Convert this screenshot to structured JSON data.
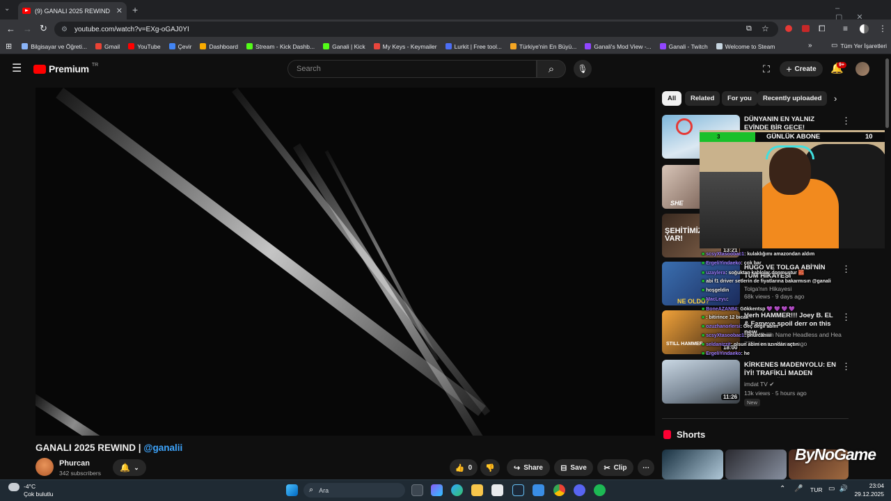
{
  "browser": {
    "tab_title": "(9) GANALI 2025 REWIND | @ga",
    "url": "youtube.com/watch?v=EXg-oGAJ0YI",
    "bookmarks": [
      {
        "label": "Bilgisayar ve Öğreti...",
        "color": "#8ab4f8"
      },
      {
        "label": "Gmail",
        "color": "#ea4335"
      },
      {
        "label": "YouTube",
        "color": "#ff0000"
      },
      {
        "label": "Çevir",
        "color": "#4285f4"
      },
      {
        "label": "Dashboard",
        "color": "#f9ab00"
      },
      {
        "label": "Stream - Kick Dashb...",
        "color": "#53fc18"
      },
      {
        "label": "Ganali | Kick",
        "color": "#53fc18"
      },
      {
        "label": "My Keys - Keymailer",
        "color": "#e8453c"
      },
      {
        "label": "Lurkit | Free tool...",
        "color": "#4c6ef5"
      },
      {
        "label": "Türkiye'nin En Büyü...",
        "color": "#f5a623"
      },
      {
        "label": "Ganali's Mod View -...",
        "color": "#9146ff"
      },
      {
        "label": "Ganali - Twitch",
        "color": "#9146ff"
      },
      {
        "label": "Welcome to Steam",
        "color": "#c7d5e0"
      }
    ],
    "bookmarks_more": "Tüm Yer İşaretleri"
  },
  "header": {
    "logo_text": "Premium",
    "logo_badge": "TR",
    "search_placeholder": "Search",
    "create_label": "Create",
    "notification_count": "9+"
  },
  "video": {
    "title_main": "GANALI 2025 REWIND | ",
    "title_mention": "@ganalii",
    "channel_name": "Phurcan",
    "subscribers": "342 subscribers",
    "likes": "0",
    "share_label": "Share",
    "save_label": "Save",
    "clip_label": "Clip"
  },
  "chips": [
    "All",
    "Related",
    "For you",
    "Recently uploaded"
  ],
  "recommendations": [
    {
      "title": "DÜNYANIN EN YALNIZ EVİNDE BİR GECE!",
      "channel": "",
      "views": "",
      "duration": ""
    },
    {
      "title": "HUGO VE TOLGA ABİ'NİN TÜM HİKAYESİ",
      "channel": "Tolga'nın Hikayesi",
      "views": "68k views · 9 days ago",
      "duration": "13:21",
      "thumb_text": "NE OLDU?"
    },
    {
      "title": "Herh HAMMER!!! Joey B. EL & Fameye spoil derr on this new ...",
      "channel": "Breakdown Name Headless and Heade...",
      "views": "772 views · 4 hours ago",
      "duration": "18:00",
      "thumb_text": "STILL HAMMER"
    },
    {
      "title": "KİRKENES MADENYOLU: EN İYİ! TRAFİKLİ MADEN YOLCULUĞU (MÜKEMMEL ...",
      "channel": "imdat TV",
      "views": "13k views · 5 hours ago",
      "duration": "11:26",
      "badge": "New"
    }
  ],
  "shorts_title": "Shorts",
  "overlay": {
    "abone_label": "GÜNLÜK ABONE",
    "abone_current": "3",
    "abone_goal": "10",
    "abone_progress": 0.3,
    "watermark": "ByNoGame",
    "chat": [
      {
        "user": "scsyXtasoobac1",
        "msg": ": kulaklığımı amazondan aldım"
      },
      {
        "user": "ErgeliYindaeko",
        "msg": ": çok bar"
      },
      {
        "user": "uzaylera",
        "msg": ": soğuktan kablolar donmuştur 🧱"
      },
      {
        "user": "",
        "msg": "abi f1 driver setlerin de fiyatlarına bakarmısın @ganali"
      },
      {
        "user": "",
        "msg": "hoşgeldin"
      },
      {
        "user": "MacLeyu",
        "msg": ":"
      },
      {
        "user": "BoneAZAN84",
        "msg": ": Gökkentsp 💜 💜 💜 💜"
      },
      {
        "user": "",
        "msg": ": bitirince 12 bıcak"
      },
      {
        "user": "ozuzhanorlersi",
        "msg": ": Geç değil abim"
      },
      {
        "user": "scsyXtasoobac1",
        "msg": ": phurcaniiii"
      },
      {
        "user": "seldanizzit",
        "msg": ": olsun abim en azından açtın"
      },
      {
        "user": "ErgeliYindaeko",
        "msg": ": he"
      }
    ]
  },
  "taskbar": {
    "weather_temp": "-4°C",
    "weather_desc": "Çok bulutlu",
    "search_label": "Ara",
    "lang": "TUR",
    "time": "23:04",
    "date": "29.12.2025"
  }
}
